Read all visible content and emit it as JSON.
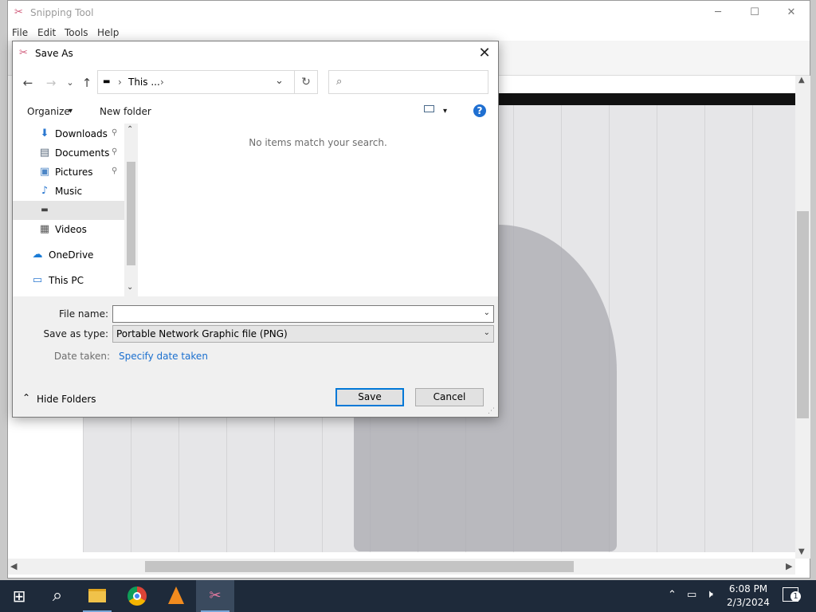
{
  "snipping_tool": {
    "title": "Snipping Tool",
    "menu": [
      "File",
      "Edit",
      "Tools",
      "Help"
    ],
    "minimize": "─",
    "maximize": "☐",
    "close": "✕"
  },
  "dialog": {
    "title": "Save As",
    "close": "✕",
    "nav": {
      "back": "←",
      "forward": "→",
      "recent": "⌄",
      "up": "↑"
    },
    "address": {
      "root": "This ...",
      "current": "",
      "chevron": "›",
      "dropdown": "⌄",
      "refresh": "↻"
    },
    "search": {
      "placeholder": ""
    },
    "command_bar": {
      "organize": "Organize",
      "organize_arrow": "▾",
      "new_folder": "New folder",
      "view_arrow": "▾",
      "help": "?"
    },
    "nav_pane": [
      {
        "label": "Downloads",
        "icon": "download-arrow-icon",
        "glyph": "⬇",
        "color": "#2b78d0",
        "pinned": true
      },
      {
        "label": "Documents",
        "icon": "documents-icon",
        "glyph": "▤",
        "color": "#5b6b7e",
        "pinned": true
      },
      {
        "label": "Pictures",
        "icon": "pictures-icon",
        "glyph": "▣",
        "color": "#4c86c6",
        "pinned": true
      },
      {
        "label": "Music",
        "icon": "music-note-icon",
        "glyph": "♪",
        "color": "#2b78d0",
        "pinned": false
      },
      {
        "label": "",
        "icon": "drive-icon",
        "glyph": "▬",
        "color": "#444444",
        "pinned": false,
        "selected": true
      },
      {
        "label": "Videos",
        "icon": "videos-icon",
        "glyph": "▦",
        "color": "#555555",
        "pinned": false
      },
      {
        "label": "OneDrive",
        "icon": "onedrive-cloud-icon",
        "glyph": "☁",
        "color": "#1a7bd6",
        "pinned": false
      },
      {
        "label": "This PC",
        "icon": "monitor-icon",
        "glyph": "▭",
        "color": "#2b78d0",
        "pinned": false
      }
    ],
    "pin_glyph": "📌",
    "empty_message": "No items match your search.",
    "file_name_label": "File name:",
    "file_name_value": "",
    "save_as_type_label": "Save as type:",
    "save_as_type_value": "Portable Network Graphic file (PNG)",
    "date_taken_label": "Date taken:",
    "date_taken_link": "Specify date taken",
    "hide_folders": "Hide Folders",
    "hide_folders_arrow": "⌃",
    "save_button": "Save",
    "cancel_button": "Cancel",
    "dropdown_glyph": "⌄"
  },
  "taskbar": {
    "start": "⊞",
    "search": "⌕",
    "apps": [
      "file-explorer-icon",
      "chrome-icon",
      "vlc-icon",
      "snipping-tool-icon"
    ],
    "tray_chevron": "⌃",
    "time": "6:08 PM",
    "date": "2/3/2024",
    "notifications": "1"
  },
  "colors": {
    "accent": "#0078d7",
    "link": "#1a6fcf",
    "taskbar": "#1e2a3a",
    "selected_nav": "#e5e5e5"
  }
}
